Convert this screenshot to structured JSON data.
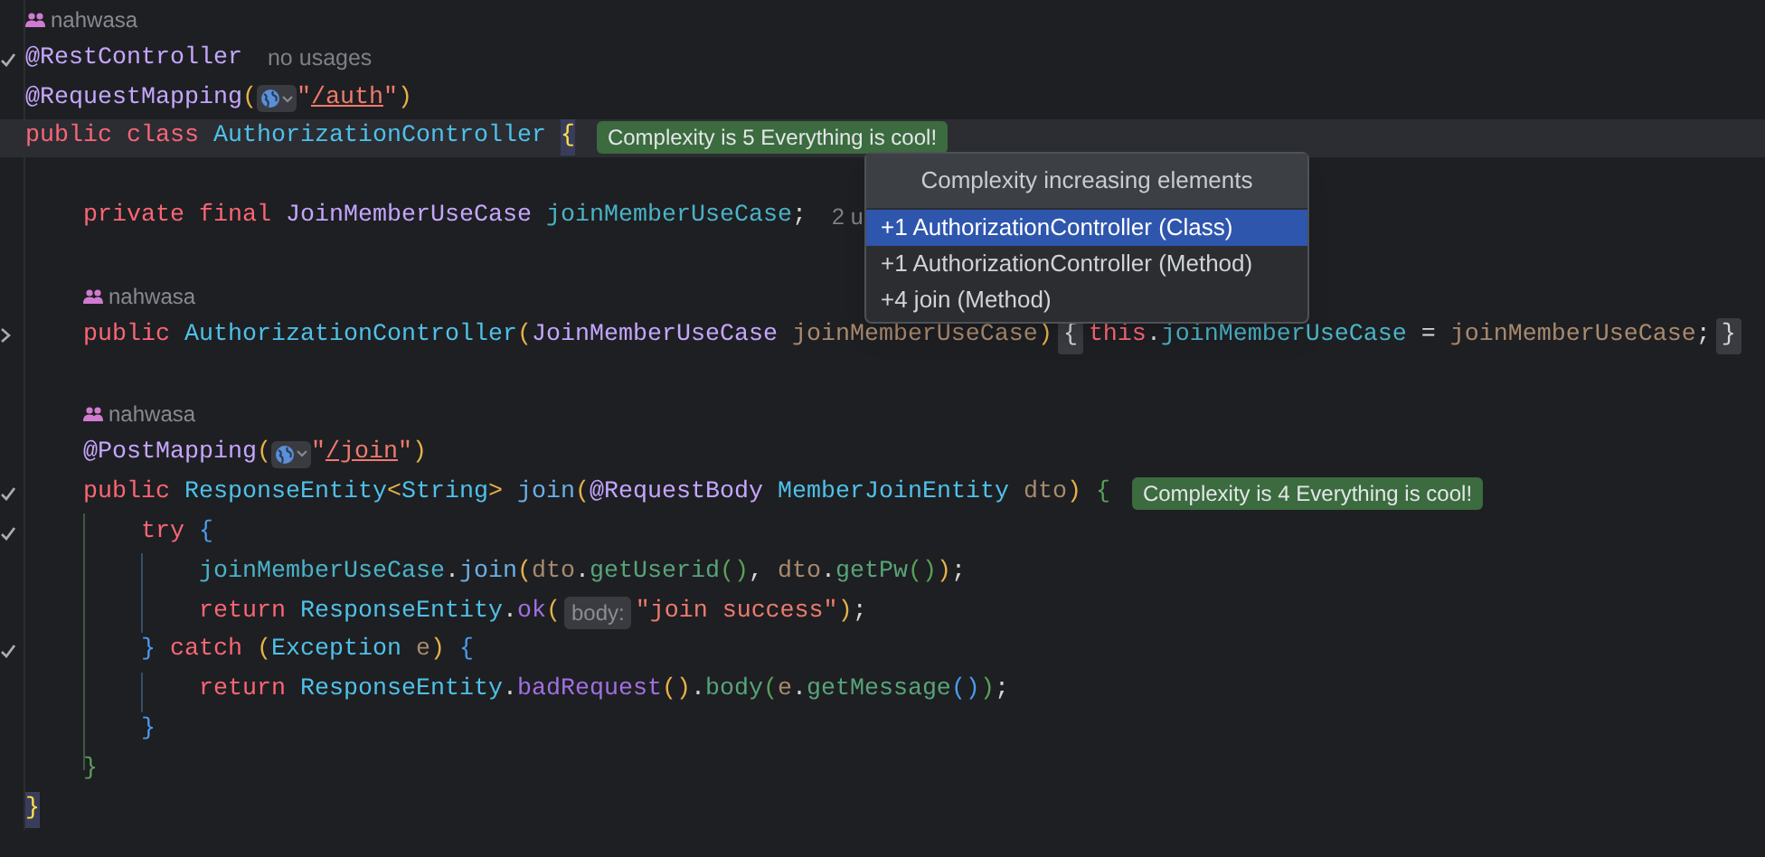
{
  "editor": {
    "blocks": [
      {
        "lines": [
          {
            "author": "nahwasa"
          },
          {
            "check_mark": true,
            "tokens": [
              {
                "kind": "ann",
                "text": "@RestController"
              },
              {
                "kind": "inlay",
                "text": "no usages"
              }
            ]
          },
          {
            "tokens": [
              {
                "kind": "ann",
                "text": "@RequestMapping"
              },
              {
                "kind": "p1",
                "text": "("
              },
              {
                "kind": "globe"
              },
              {
                "kind": "str",
                "text": "\""
              },
              {
                "kind": "url",
                "text": "/auth"
              },
              {
                "kind": "str",
                "text": "\""
              },
              {
                "kind": "p1",
                "text": ")"
              }
            ]
          },
          {
            "current": true,
            "tokens": [
              {
                "kind": "kw",
                "text": "public class "
              },
              {
                "kind": "cls",
                "text": "AuthorizationController "
              },
              {
                "kind": "brace",
                "text": "{"
              },
              {
                "kind": "badge",
                "text": "Complexity is 5 Everything is cool!"
              }
            ]
          }
        ]
      },
      {
        "lines": [
          {
            "tokens": [
              {
                "kind": "kw",
                "text": "    private final "
              },
              {
                "kind": "type",
                "text": "JoinMemberUseCase "
              },
              {
                "kind": "field",
                "text": "joinMemberUseCase"
              },
              {
                "kind": "plain",
                "text": ";"
              },
              {
                "kind": "inlay",
                "text": "2 u"
              }
            ]
          }
        ]
      },
      {
        "lines": [
          {
            "author": "    nahwasa"
          },
          {
            "collapsed": true,
            "tokens": [
              {
                "kind": "kw",
                "text": "    public "
              },
              {
                "kind": "cls",
                "text": "AuthorizationController"
              },
              {
                "kind": "p1",
                "text": "("
              },
              {
                "kind": "type",
                "text": "JoinMemberUseCase "
              },
              {
                "kind": "param",
                "text": "joinMemberUseCase"
              },
              {
                "kind": "p1",
                "text": ")"
              },
              {
                "kind": "fold",
                "text": "{"
              },
              {
                "kind": "kw",
                "text": "this"
              },
              {
                "kind": "plain",
                "text": "."
              },
              {
                "kind": "field",
                "text": "joinMemberUseCase"
              },
              {
                "kind": "plain",
                "text": " = "
              },
              {
                "kind": "param",
                "text": "joinMemberUseCase"
              },
              {
                "kind": "plain",
                "text": ";"
              },
              {
                "kind": "fold",
                "text": "}"
              }
            ]
          }
        ]
      },
      {
        "lines": [
          {
            "author": "    nahwasa"
          },
          {
            "tokens": [
              {
                "kind": "ann",
                "text": "    @PostMapping"
              },
              {
                "kind": "p1",
                "text": "("
              },
              {
                "kind": "globe"
              },
              {
                "kind": "str",
                "text": "\""
              },
              {
                "kind": "url",
                "text": "/join"
              },
              {
                "kind": "str",
                "text": "\""
              },
              {
                "kind": "p1",
                "text": ")"
              }
            ]
          },
          {
            "check_mark": true,
            "tokens": [
              {
                "kind": "kw",
                "text": "    public "
              },
              {
                "kind": "cls",
                "text": "ResponseEntity"
              },
              {
                "kind": "p1",
                "text": "<"
              },
              {
                "kind": "cls",
                "text": "String"
              },
              {
                "kind": "p1",
                "text": ">"
              },
              {
                "kind": "call",
                "text": " join"
              },
              {
                "kind": "p1",
                "text": "("
              },
              {
                "kind": "ann",
                "text": "@RequestBody "
              },
              {
                "kind": "cls",
                "text": "MemberJoinEntity "
              },
              {
                "kind": "param",
                "text": "dto"
              },
              {
                "kind": "p1",
                "text": ")"
              },
              {
                "kind": "p2",
                "text": " {"
              },
              {
                "kind": "badge",
                "text": "Complexity is 4 Everything is cool!"
              }
            ]
          },
          {
            "check_mark": true,
            "tokens": [
              {
                "kind": "kw",
                "text": "        try "
              },
              {
                "kind": "p3",
                "text": "{"
              }
            ]
          },
          {
            "tokens": [
              {
                "kind": "field",
                "text": "            joinMemberUseCase"
              },
              {
                "kind": "plain",
                "text": "."
              },
              {
                "kind": "call",
                "text": "join"
              },
              {
                "kind": "p1",
                "text": "("
              },
              {
                "kind": "param",
                "text": "dto"
              },
              {
                "kind": "plain",
                "text": "."
              },
              {
                "kind": "call2",
                "text": "getUserid"
              },
              {
                "kind": "p2",
                "text": "()"
              },
              {
                "kind": "plain",
                "text": ", "
              },
              {
                "kind": "param",
                "text": "dto"
              },
              {
                "kind": "plain",
                "text": "."
              },
              {
                "kind": "call2",
                "text": "getPw"
              },
              {
                "kind": "p2",
                "text": "()"
              },
              {
                "kind": "p1",
                "text": ")"
              },
              {
                "kind": "plain",
                "text": ";"
              }
            ]
          },
          {
            "tokens": [
              {
                "kind": "kw",
                "text": "            return "
              },
              {
                "kind": "cls",
                "text": "ResponseEntity"
              },
              {
                "kind": "plain",
                "text": "."
              },
              {
                "kind": "call3",
                "text": "ok"
              },
              {
                "kind": "p1",
                "text": "("
              },
              {
                "kind": "hint",
                "text": "body:"
              },
              {
                "kind": "str",
                "text": "\"join success\""
              },
              {
                "kind": "p1",
                "text": ")"
              },
              {
                "kind": "plain",
                "text": ";"
              }
            ]
          },
          {
            "check_mark": true,
            "tokens": [
              {
                "kind": "p3",
                "text": "        }"
              },
              {
                "kind": "kw",
                "text": " catch "
              },
              {
                "kind": "p1",
                "text": "("
              },
              {
                "kind": "cls",
                "text": "Exception "
              },
              {
                "kind": "param",
                "text": "e"
              },
              {
                "kind": "p1",
                "text": ")"
              },
              {
                "kind": "p3",
                "text": " {"
              }
            ]
          },
          {
            "tokens": [
              {
                "kind": "kw",
                "text": "            return "
              },
              {
                "kind": "cls",
                "text": "ResponseEntity"
              },
              {
                "kind": "plain",
                "text": "."
              },
              {
                "kind": "call3",
                "text": "badRequest"
              },
              {
                "kind": "p1",
                "text": "()"
              },
              {
                "kind": "plain",
                "text": "."
              },
              {
                "kind": "call2",
                "text": "body"
              },
              {
                "kind": "p2",
                "text": "("
              },
              {
                "kind": "param",
                "text": "e"
              },
              {
                "kind": "plain",
                "text": "."
              },
              {
                "kind": "call2",
                "text": "getMessage"
              },
              {
                "kind": "p3",
                "text": "()"
              },
              {
                "kind": "p2",
                "text": ")"
              },
              {
                "kind": "plain",
                "text": ";"
              }
            ]
          },
          {
            "tokens": [
              {
                "kind": "p3",
                "text": "        }"
              }
            ]
          },
          {
            "tokens": [
              {
                "kind": "p2",
                "text": "    }"
              }
            ]
          },
          {
            "tokens": [
              {
                "kind": "brace",
                "text": "}"
              }
            ]
          }
        ]
      }
    ]
  },
  "popup": {
    "title": "Complexity increasing elements",
    "items": [
      {
        "label": "+1 AuthorizationController (Class)",
        "selected": true
      },
      {
        "label": "+1 AuthorizationController (Method)",
        "selected": false
      },
      {
        "label": "+4 join (Method)",
        "selected": false
      }
    ]
  }
}
